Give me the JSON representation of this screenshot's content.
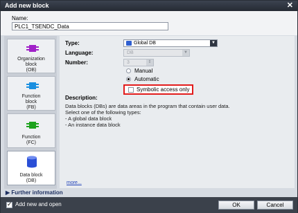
{
  "window": {
    "title": "Add new block",
    "close": "✕"
  },
  "name": {
    "label": "Name:",
    "value": "PLC1_TSENDC_Data"
  },
  "sidebar": {
    "items": [
      {
        "line1": "Organization",
        "line2": "block",
        "line3": "(OB)",
        "color": "#a020c8"
      },
      {
        "line1": "Function",
        "line2": "block",
        "line3": "(FB)",
        "color": "#1a8fe0"
      },
      {
        "line1": "Function",
        "line2": "(FC)",
        "color": "#1da21d"
      },
      {
        "line1": "Data block",
        "line2": "(DB)",
        "color": "#2a4fd6",
        "selected": true
      }
    ]
  },
  "form": {
    "type_label": "Type:",
    "type_value": "Global DB",
    "language_label": "Language:",
    "language_value": "DB",
    "number_label": "Number:",
    "number_value": "3",
    "manual_label": "Manual",
    "automatic_label": "Automatic",
    "symbolic_label": "Symbolic access only",
    "description_label": "Description:",
    "description_lines": [
      "Data blocks (DBs) are data areas in the program that contain user data.",
      "Select one of the following types:",
      "- A global data block",
      "- An instance data block"
    ],
    "more_label": "more..."
  },
  "further_info": "Further information",
  "bottom": {
    "add_open_label": "Add new and open",
    "ok_label": "OK",
    "cancel_label": "Cancel"
  },
  "colors": {
    "highlight": "#e21b1b",
    "titlebar": "#2b313c"
  }
}
